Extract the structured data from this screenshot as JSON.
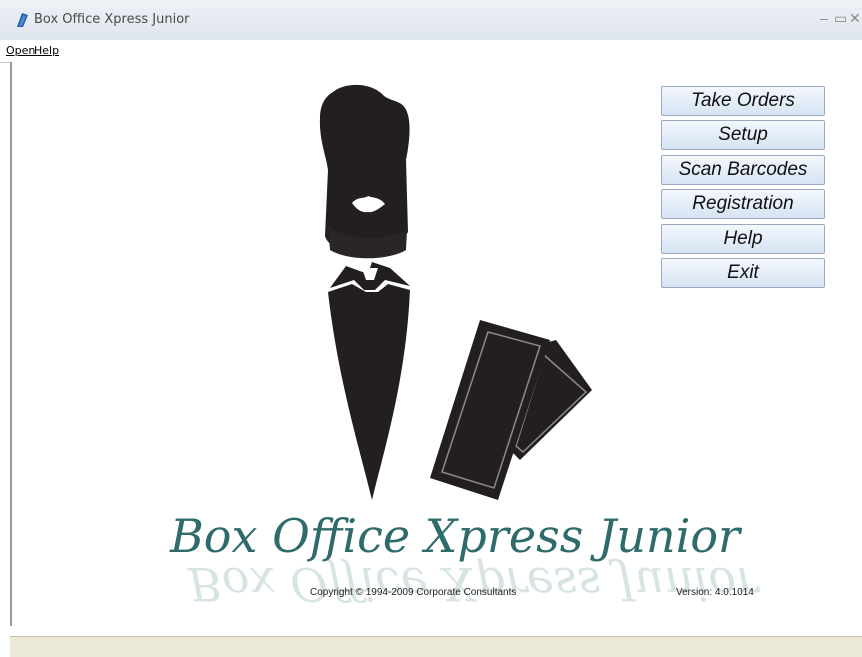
{
  "window": {
    "title": "Box Office Xpress Junior"
  },
  "menu": {
    "items": [
      "Open",
      "Help"
    ]
  },
  "buttons": [
    "Take Orders",
    "Setup",
    "Scan Barcodes",
    "Registration",
    "Help",
    "Exit"
  ],
  "logo": {
    "text": "Box Office Xpress Junior"
  },
  "footer": {
    "copyright": "Copyright © 1994-2009 Corporate Consultants",
    "version": "Version: 4.0.1014"
  },
  "icons": {
    "app": "ticket-app-icon",
    "minimize": "minimize-icon",
    "maximize": "maximize-icon",
    "close": "close-icon"
  },
  "colors": {
    "logo_text": "#2f6b6a",
    "figure": "#231f20",
    "button_top": "#f4f8fd",
    "button_bottom": "#d6e3f3"
  }
}
